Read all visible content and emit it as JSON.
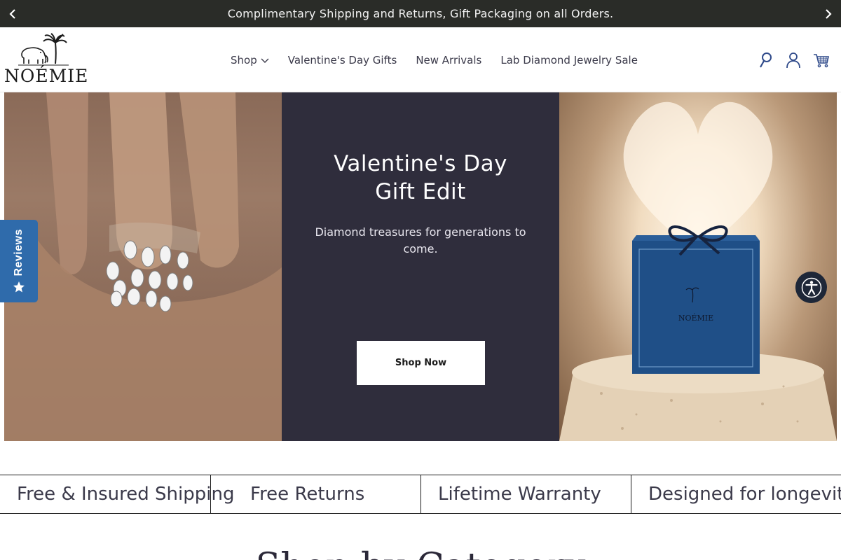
{
  "announcement": {
    "text": "Complimentary Shipping and Returns, Gift Packaging on all Orders."
  },
  "header": {
    "logo_text": "NOÉMIE",
    "nav": [
      {
        "label": "Shop"
      },
      {
        "label": "Valentine's Day Gifts"
      },
      {
        "label": "New Arrivals"
      },
      {
        "label": "Lab Diamond Jewelry Sale"
      }
    ],
    "icons": [
      "search-icon",
      "account-icon",
      "cart-icon"
    ]
  },
  "hero": {
    "title_line1": "Valentine's Day",
    "title_line2": "Gift Edit",
    "subtitle": "Diamond treasures for generations to come.",
    "button_label": "Shop Now",
    "box_logo_text": "NOÉMIE"
  },
  "reviews_tab": {
    "label": "Reviews"
  },
  "marquee": {
    "items": [
      "Free & Insured Shipping",
      "Free Returns",
      "Lifetime Warranty",
      "Designed for longevity"
    ]
  },
  "bottom_heading": "Shop by Category",
  "colors": {
    "announcement_bg": "#2a2c28",
    "hero_mid_bg": "#2f2d3c",
    "reviews_tab_bg": "#2f6bab",
    "accessibility_bg": "#1e2738",
    "gift_box": "#1f4f87"
  }
}
